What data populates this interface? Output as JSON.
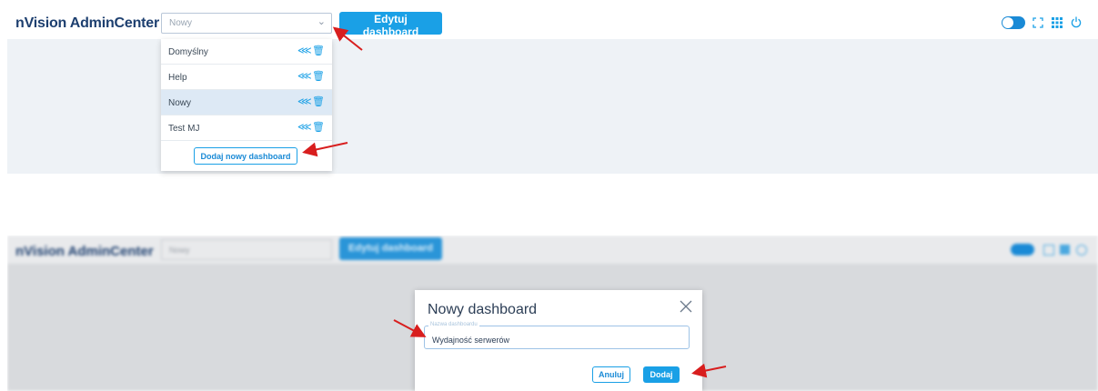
{
  "app": {
    "title": "nVision AdminCenter"
  },
  "dashboard_select": {
    "value": "Nowy",
    "chevron": "chevron-down-icon"
  },
  "toolbar": {
    "edit_label": "Edytuj dashboard"
  },
  "dropdown": {
    "items": [
      {
        "label": "Domyślny",
        "selected": false
      },
      {
        "label": "Help",
        "selected": false
      },
      {
        "label": "Nowy",
        "selected": true
      },
      {
        "label": "Test MJ",
        "selected": false
      }
    ],
    "add_label": "Dodaj nowy dashboard"
  },
  "header_icons": [
    "theme-toggle-icon",
    "fullscreen-icon",
    "apps-grid-icon",
    "power-icon"
  ],
  "modal": {
    "title": "Nowy dashboard",
    "field_legend": "Nazwa dashboardu",
    "field_value": "Wydajność serwerów",
    "cancel_label": "Anuluj",
    "add_label": "Dodaj"
  },
  "colors": {
    "accent": "#1aa0e6",
    "brand": "#1d3f6f",
    "annotation": "#d81e1e"
  }
}
